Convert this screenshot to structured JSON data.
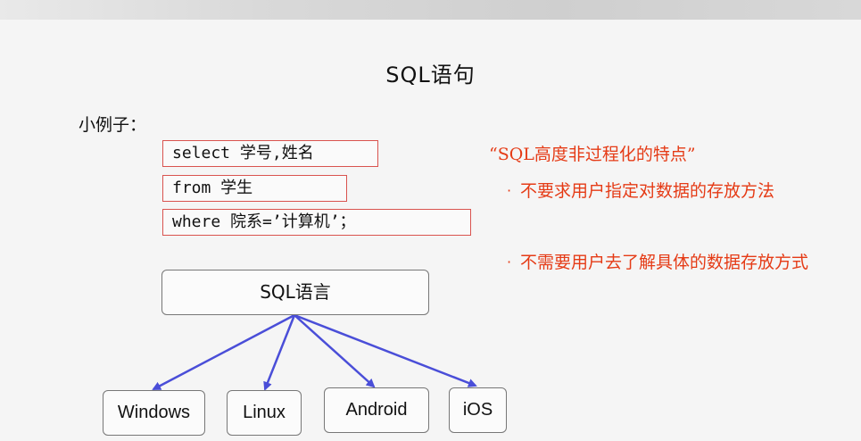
{
  "slide": {
    "title": "SQL语句",
    "example_label": "小例子：",
    "code_lines": [
      "select 学号,姓名",
      "from 学生",
      "where 院系=’计算机’；"
    ],
    "quote": "“SQL高度非过程化的特点”",
    "bullets": [
      {
        "dot": "·",
        "text": "不要求用户指定对数据的存放方法"
      },
      {
        "dot": "·",
        "text": "不需要用户去了解具体的数据存放方式"
      }
    ],
    "diagram": {
      "root_label": "SQL语言",
      "targets": [
        "Windows",
        "Linux",
        "Android",
        "iOS"
      ]
    }
  },
  "colors": {
    "accent_red": "#e53b16",
    "box_border_red": "#d9534f",
    "arrow_blue": "#4a4ed8"
  }
}
